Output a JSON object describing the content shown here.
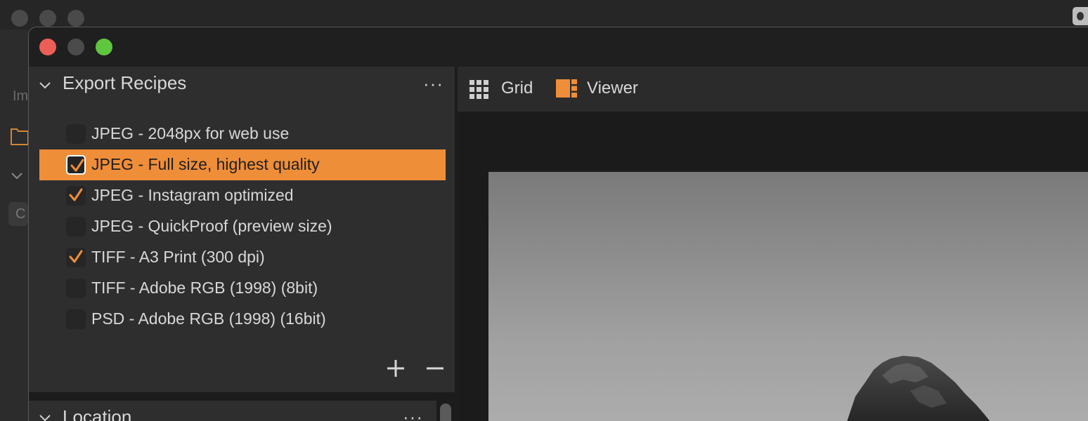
{
  "background_window": {
    "sidebar_text": "Im",
    "pill_text": "C"
  },
  "export_recipes": {
    "title": "Export Recipes",
    "more_label": "···",
    "items": [
      {
        "label": "JPEG - 2048px for web use",
        "checked": false,
        "selected": false
      },
      {
        "label": "JPEG - Full size, highest quality",
        "checked": true,
        "selected": true
      },
      {
        "label": "JPEG - Instagram optimized",
        "checked": true,
        "selected": false
      },
      {
        "label": "JPEG - QuickProof (preview size)",
        "checked": false,
        "selected": false
      },
      {
        "label": "TIFF - A3 Print (300 dpi)",
        "checked": true,
        "selected": false
      },
      {
        "label": "TIFF - Adobe RGB (1998) (8bit)",
        "checked": false,
        "selected": false
      },
      {
        "label": "PSD - Adobe RGB (1998) (16bit)",
        "checked": false,
        "selected": false
      }
    ],
    "add_icon": "plus-icon",
    "remove_icon": "minus-icon"
  },
  "location_panel": {
    "title": "Location",
    "more_label": "···"
  },
  "toolbar": {
    "grid_label": "Grid",
    "viewer_label": "Viewer"
  },
  "colors": {
    "accent": "#ef8e38",
    "close": "#ec5f57",
    "zoom": "#5fc63f"
  }
}
